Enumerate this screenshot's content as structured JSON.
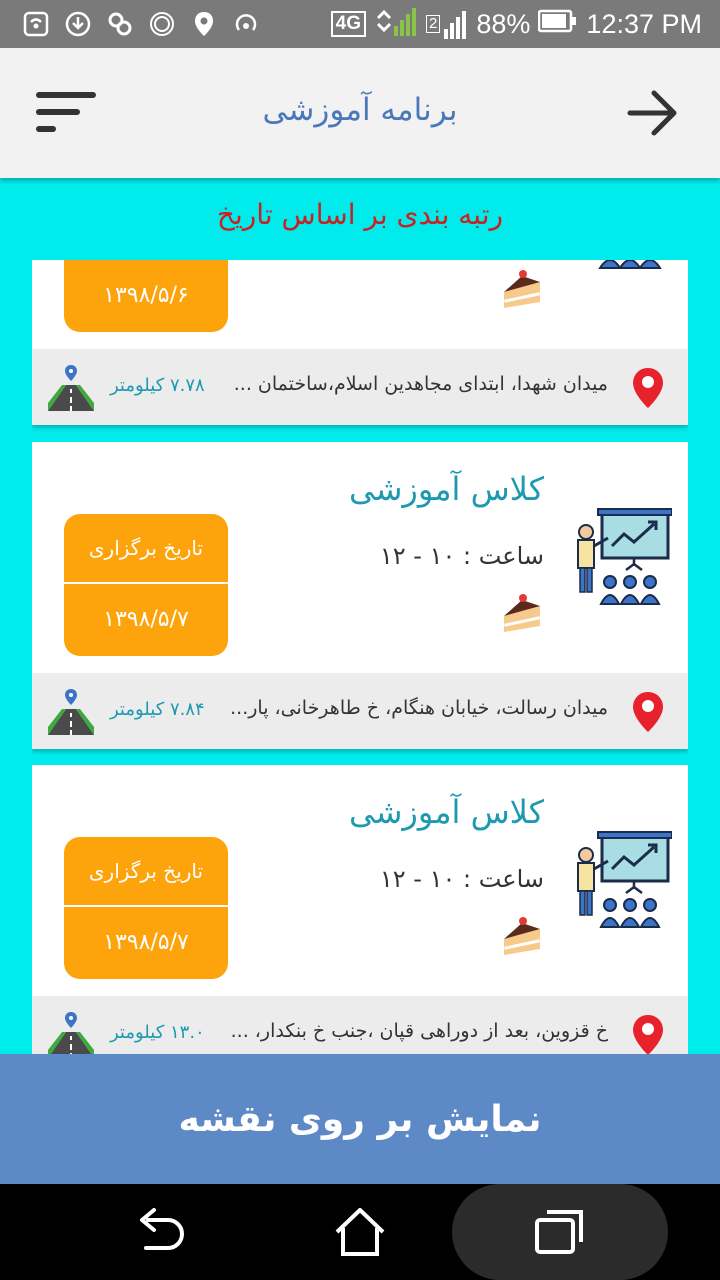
{
  "status_bar": {
    "battery": "88%",
    "time": "12:37 PM",
    "network": "4G",
    "sim": "2"
  },
  "header": {
    "title": "برنامه آموزشی"
  },
  "sort_label": "رتبه بندی بر اساس تاریخ",
  "cards": [
    {
      "title": "",
      "time": "",
      "date_label": "",
      "date": "۱۳۹۸/۵/۶",
      "address": "میدان شهدا، ابتدای مجاهدین اسلام،ساختمان ...",
      "distance": "۷.۷۸ کیلومتر"
    },
    {
      "title": "کلاس آموزشی",
      "time": "ساعت : ۱۰ - ۱۲",
      "date_label": "تاریخ برگزاری",
      "date": "۱۳۹۸/۵/۷",
      "address": "میدان رسالت، خیابان هنگام، خ طاهرخانی، پار...",
      "distance": "۷.۸۴ کیلومتر"
    },
    {
      "title": "کلاس آموزشی",
      "time": "ساعت : ۱۰ - ۱۲",
      "date_label": "تاریخ برگزاری",
      "date": "۱۳۹۸/۵/۷",
      "address": "خ قزوین، بعد از دوراهی قپان ،جنب خ بنکدار، ...",
      "distance": "۱۳.۰ کیلومتر"
    }
  ],
  "map_button": "نمایش بر روی نقشه",
  "colors": {
    "accent": "#00ECEC",
    "date_box": "#fda30b",
    "map_button": "#5d89c7",
    "title": "#1e9ab0"
  },
  "icons": [
    "menu-icon",
    "back-arrow-icon",
    "cake-icon",
    "training-class-icon",
    "location-pin-icon",
    "road-icon",
    "nav-back-icon",
    "nav-home-icon",
    "nav-recents-icon"
  ]
}
